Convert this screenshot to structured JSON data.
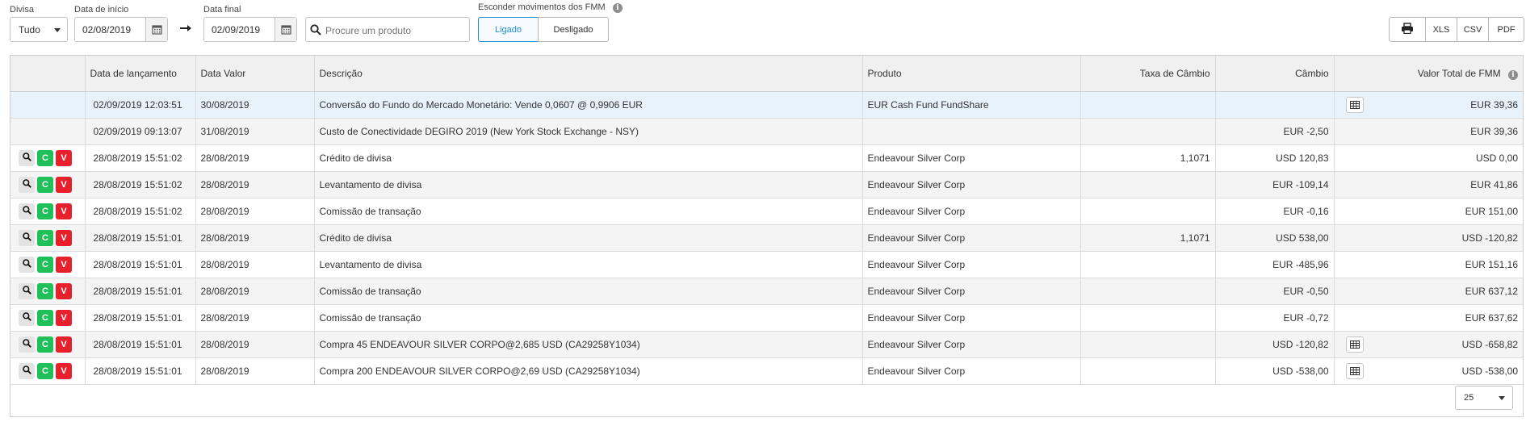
{
  "filters": {
    "currency": {
      "label": "Divisa",
      "value": "Tudo"
    },
    "start_date": {
      "label": "Data de início",
      "value": "02/08/2019"
    },
    "end_date": {
      "label": "Data final",
      "value": "02/09/2019"
    },
    "search": {
      "placeholder": "Procure um produto"
    },
    "hide_fmm": {
      "label": "Esconder movimentos dos FMM",
      "on_label": "Ligado",
      "off_label": "Desligado",
      "selected": "Ligado"
    }
  },
  "exports": {
    "xls": "XLS",
    "csv": "CSV",
    "pdf": "PDF"
  },
  "table": {
    "headers": [
      "Data de lançamento",
      "Data Valor",
      "Descrição",
      "Produto",
      "Taxa de Câmbio",
      "Câmbio",
      "Valor Total de FMM"
    ],
    "rows": [
      {
        "actions": false,
        "date": "02/09/2019 12:03:51",
        "value_date": "30/08/2019",
        "description": "Conversão do Fundo do Mercado Monetário: Vende 0,0607 @ 0,9906 EUR",
        "product": "EUR Cash Fund FundShare",
        "fx_rate": "",
        "exchange": "",
        "total": "EUR 39,36",
        "table_icon": true
      },
      {
        "actions": false,
        "date": "02/09/2019 09:13:07",
        "value_date": "31/08/2019",
        "description": "Custo de Conectividade DEGIRO 2019 (New York Stock Exchange - NSY)",
        "product": "",
        "fx_rate": "",
        "exchange": "EUR -2,50",
        "total": "EUR 39,36",
        "table_icon": false
      },
      {
        "actions": true,
        "date": "28/08/2019 15:51:02",
        "value_date": "28/08/2019",
        "description": "Crédito de divisa",
        "product": "Endeavour Silver Corp",
        "fx_rate": "1,1071",
        "exchange": "USD 120,83",
        "total": "USD 0,00",
        "table_icon": false
      },
      {
        "actions": true,
        "date": "28/08/2019 15:51:02",
        "value_date": "28/08/2019",
        "description": "Levantamento de divisa",
        "product": "Endeavour Silver Corp",
        "fx_rate": "",
        "exchange": "EUR -109,14",
        "total": "EUR 41,86",
        "table_icon": false
      },
      {
        "actions": true,
        "date": "28/08/2019 15:51:02",
        "value_date": "28/08/2019",
        "description": "Comissão de transação",
        "product": "Endeavour Silver Corp",
        "fx_rate": "",
        "exchange": "EUR -0,16",
        "total": "EUR 151,00",
        "table_icon": false
      },
      {
        "actions": true,
        "date": "28/08/2019 15:51:01",
        "value_date": "28/08/2019",
        "description": "Crédito de divisa",
        "product": "Endeavour Silver Corp",
        "fx_rate": "1,1071",
        "exchange": "USD 538,00",
        "total": "USD -120,82",
        "table_icon": false
      },
      {
        "actions": true,
        "date": "28/08/2019 15:51:01",
        "value_date": "28/08/2019",
        "description": "Levantamento de divisa",
        "product": "Endeavour Silver Corp",
        "fx_rate": "",
        "exchange": "EUR -485,96",
        "total": "EUR 151,16",
        "table_icon": false
      },
      {
        "actions": true,
        "date": "28/08/2019 15:51:01",
        "value_date": "28/08/2019",
        "description": "Comissão de transação",
        "product": "Endeavour Silver Corp",
        "fx_rate": "",
        "exchange": "EUR -0,50",
        "total": "EUR 637,12",
        "table_icon": false
      },
      {
        "actions": true,
        "date": "28/08/2019 15:51:01",
        "value_date": "28/08/2019",
        "description": "Comissão de transação",
        "product": "Endeavour Silver Corp",
        "fx_rate": "",
        "exchange": "EUR -0,72",
        "total": "EUR 637,62",
        "table_icon": false
      },
      {
        "actions": true,
        "date": "28/08/2019 15:51:01",
        "value_date": "28/08/2019",
        "description": "Compra 45 ENDEAVOUR SILVER CORPO@2,685 USD (CA29258Y1034)",
        "product": "Endeavour Silver Corp",
        "fx_rate": "",
        "exchange": "USD -120,82",
        "total": "USD -658,82",
        "table_icon": true
      },
      {
        "actions": true,
        "date": "28/08/2019 15:51:01",
        "value_date": "28/08/2019",
        "description": "Compra 200 ENDEAVOUR SILVER CORPO@2,69 USD (CA29258Y1034)",
        "product": "Endeavour Silver Corp",
        "fx_rate": "",
        "exchange": "USD -538,00",
        "total": "USD -538,00",
        "table_icon": true
      }
    ],
    "action_labels": {
      "c": "C",
      "v": "V"
    }
  },
  "pagination": {
    "page_size": "25"
  },
  "colors": {
    "accent": "#1e90d7",
    "buy": "#1fbf5a",
    "sell": "#e8202b"
  }
}
